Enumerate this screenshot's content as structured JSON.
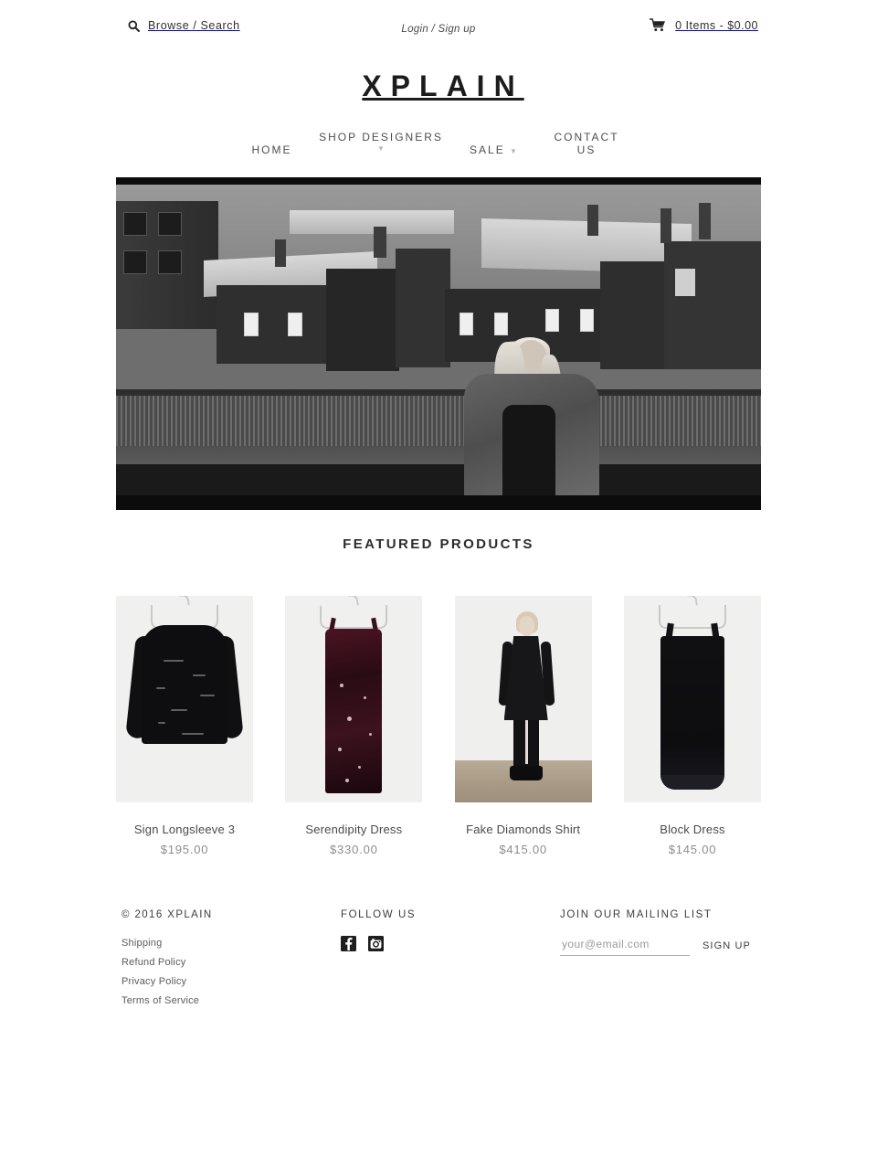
{
  "topbar": {
    "search_label": "Browse / Search",
    "search_icon": "search-icon",
    "account_label": "Login / Sign up",
    "cart_icon": "shopping-cart-icon",
    "cart_label": "0 Items - $0.00"
  },
  "brand": {
    "logo_text": "XPLAIN"
  },
  "nav": {
    "home": "HOME",
    "shop_designers": "SHOP DESIGNERS",
    "shop_caret": "▼",
    "sale": "SALE",
    "sale_caret": "▼",
    "contact_line1": "CONTACT",
    "contact_line2": "US"
  },
  "hero": {
    "alt": "black and white photo of a model on a city rooftop"
  },
  "featured": {
    "heading": "FEATURED PRODUCTS",
    "products": [
      {
        "name": "Sign Longsleeve 3",
        "price": "$195.00"
      },
      {
        "name": "Serendipity Dress",
        "price": "$330.00"
      },
      {
        "name": "Fake Diamonds Shirt",
        "price": "$415.00"
      },
      {
        "name": "Block Dress",
        "price": "$145.00"
      }
    ]
  },
  "footer": {
    "copyright": "© 2016 XPLAIN",
    "links": [
      "Shipping",
      "Refund Policy",
      "Privacy Policy",
      "Terms of Service"
    ],
    "social_heading": "FOLLOW US",
    "social": [
      {
        "name": "facebook-icon"
      },
      {
        "name": "instagram-icon"
      }
    ],
    "mail_heading": "JOIN OUR MAILING LIST",
    "email_placeholder": "your@email.com",
    "email_value": "",
    "signup_label": "SIGN UP"
  },
  "colors": {
    "text": "#3a3a3a",
    "muted": "#8d8d8d",
    "logo": "#1c1c1c",
    "hero_frame": "#0c0c0c"
  }
}
